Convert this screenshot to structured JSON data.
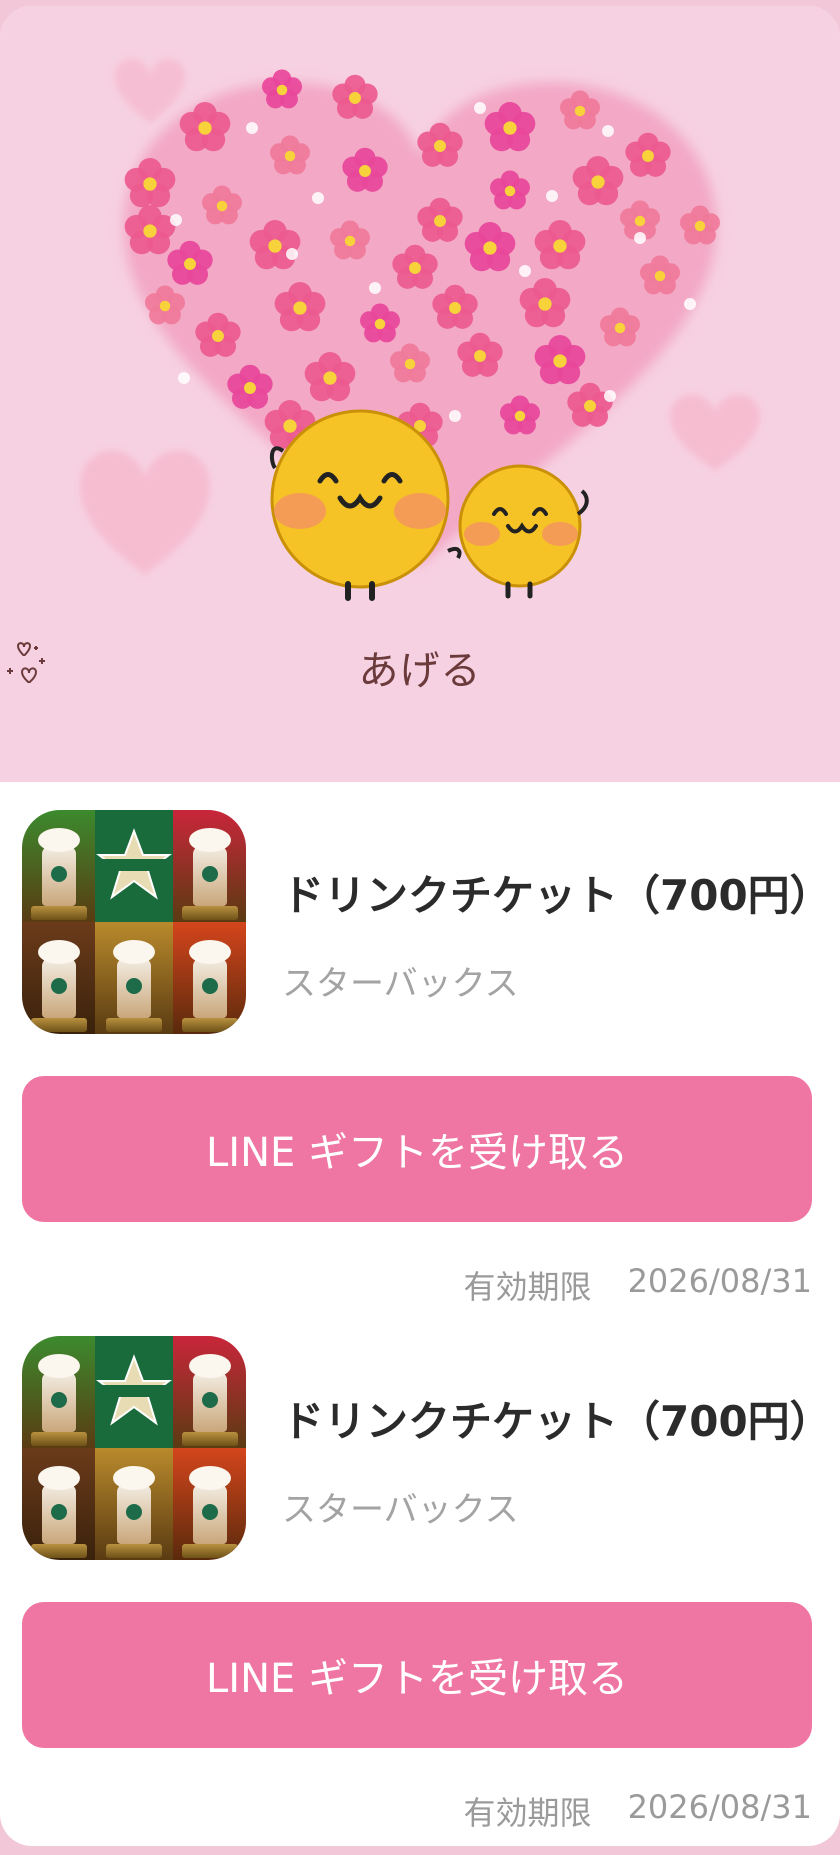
{
  "banner": {
    "caption": "あげる",
    "caption_icon": "sparkle-hearts-icon",
    "colors": {
      "background": "#f6d1e1",
      "heart": "#f3a8c6",
      "flower": "#ec5a8e"
    }
  },
  "gifts": [
    {
      "name": "ドリンクチケット（700円）",
      "brand": "スターバックス",
      "button_label": "LINE ギフトを受け取る",
      "expiry_label": "有効期限",
      "expiry_date": "2026/08/31"
    },
    {
      "name": "ドリンクチケット（700円）",
      "brand": "スターバックス",
      "button_label": "LINE ギフトを受け取る",
      "expiry_label": "有効期限",
      "expiry_date": "2026/08/31"
    }
  ],
  "colors": {
    "accent": "#ef76a2",
    "page_background": "#f2c8d8"
  }
}
